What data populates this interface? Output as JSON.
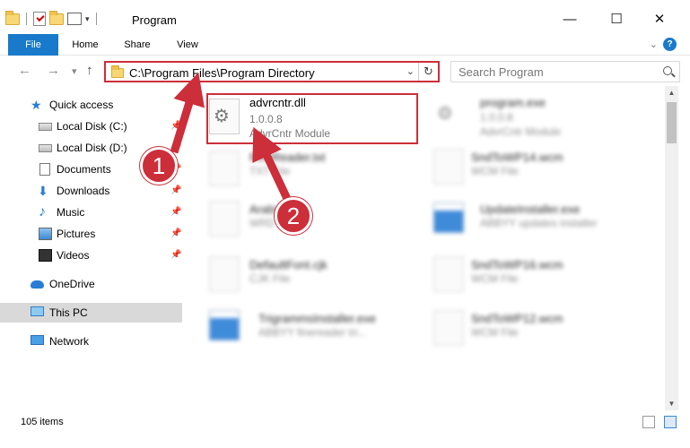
{
  "window": {
    "title": "Program",
    "minimize_glyph": "—",
    "maximize_glyph": "☐",
    "close_glyph": "✕"
  },
  "ribbon": {
    "tabs": [
      {
        "label": "File"
      },
      {
        "label": "Home"
      },
      {
        "label": "Share"
      },
      {
        "label": "View"
      }
    ],
    "help_glyph": "?"
  },
  "navigation": {
    "back_glyph": "←",
    "forward_glyph": "→",
    "recent_glyph": "▾",
    "up_glyph": "↑",
    "address_path": "C:\\Program Files\\Program Directory",
    "address_dropdown_glyph": "⌄",
    "refresh_glyph": "↻",
    "search_placeholder": "Search Program"
  },
  "sidebar": {
    "items": [
      {
        "label": "Quick access",
        "icon": "star-icon"
      },
      {
        "label": "Local Disk (C:)",
        "icon": "disk-icon"
      },
      {
        "label": "Local Disk (D:)",
        "icon": "disk-icon"
      },
      {
        "label": "Documents",
        "icon": "documents-icon"
      },
      {
        "label": "Downloads",
        "icon": "downloads-icon"
      },
      {
        "label": "Music",
        "icon": "music-icon"
      },
      {
        "label": "Pictures",
        "icon": "pictures-icon"
      },
      {
        "label": "Videos",
        "icon": "videos-icon"
      },
      {
        "label": "OneDrive",
        "icon": "onedrive-icon"
      },
      {
        "label": "This PC",
        "icon": "this-pc-icon"
      },
      {
        "label": "Network",
        "icon": "network-icon"
      }
    ],
    "pin_glyph": "📌"
  },
  "files": [
    {
      "name": "advrcntr.dll",
      "version": "1.0.0.8",
      "description": "AdvrCntr Module"
    },
    {
      "name": "program.exe",
      "version": "1.0.0.8",
      "description": "AdvrCntr Module"
    },
    {
      "name": "FineReader.txt",
      "version": "",
      "description": "TXT File"
    },
    {
      "name": "SndToWP14.wcm",
      "version": "",
      "description": "WCM File"
    },
    {
      "name": "Arabic.ini",
      "version": "",
      "description": "WRD File"
    },
    {
      "name": "UpdateInstaller.exe",
      "version": "",
      "description": "ABBYY updates installer"
    },
    {
      "name": "DefaultFont.cjk",
      "version": "",
      "description": "CJK File"
    },
    {
      "name": "SndToWP16.wcm",
      "version": "",
      "description": "WCM File"
    },
    {
      "name": "TrigrammsInstaller.exe",
      "version": "",
      "description": "ABBYY finereader tri..."
    },
    {
      "name": "SndToWP12.wcm",
      "version": "",
      "description": "WCM File"
    }
  ],
  "annotations": {
    "step1": "1",
    "step2": "2",
    "color": "#cc2e3a"
  },
  "status": {
    "item_count": "105 items"
  },
  "scrollbar": {
    "up_glyph": "▲",
    "down_glyph": "▼"
  }
}
